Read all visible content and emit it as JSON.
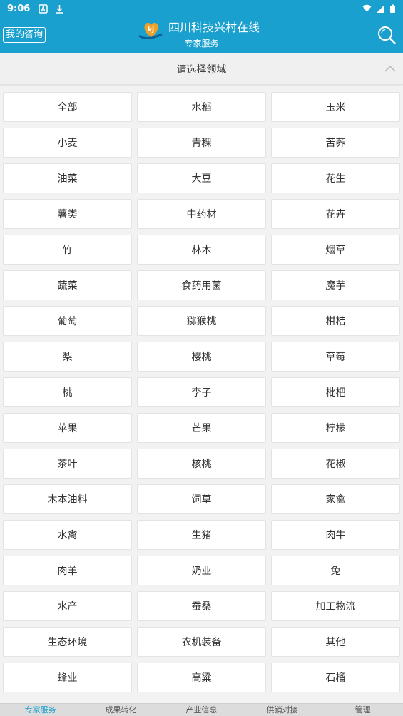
{
  "status_bar": {
    "time": "9:06"
  },
  "header": {
    "my_consult_label": "我的咨询",
    "app_title": "四川科技兴村在线",
    "subtitle": "专家服务",
    "logo_text": "kj"
  },
  "filter": {
    "label": "请选择领域"
  },
  "domains": [
    "全部",
    "水稻",
    "玉米",
    "小麦",
    "青稞",
    "苦荞",
    "油菜",
    "大豆",
    "花生",
    "薯类",
    "中药材",
    "花卉",
    "竹",
    "林木",
    "烟草",
    "蔬菜",
    "食药用菌",
    "魔芋",
    "葡萄",
    "猕猴桃",
    "柑桔",
    "梨",
    "樱桃",
    "草莓",
    "桃",
    "李子",
    "枇杷",
    "苹果",
    "芒果",
    "柠檬",
    "茶叶",
    "核桃",
    "花椒",
    "木本油料",
    "饲草",
    "家禽",
    "水禽",
    "生猪",
    "肉牛",
    "肉羊",
    "奶业",
    "兔",
    "水产",
    "蚕桑",
    "加工物流",
    "生态环境",
    "农机装备",
    "其他",
    "蜂业",
    "高粱",
    "石榴"
  ],
  "bottom_nav": [
    {
      "label": "专家服务",
      "active": true
    },
    {
      "label": "成果转化",
      "active": false
    },
    {
      "label": "产业信息",
      "active": false
    },
    {
      "label": "供销对接",
      "active": false
    },
    {
      "label": "管理",
      "active": false
    }
  ],
  "colors": {
    "primary": "#1aa0cf",
    "background": "#f2f2f2",
    "cell_background": "#ffffff",
    "logo_heart": "#f0a028"
  }
}
